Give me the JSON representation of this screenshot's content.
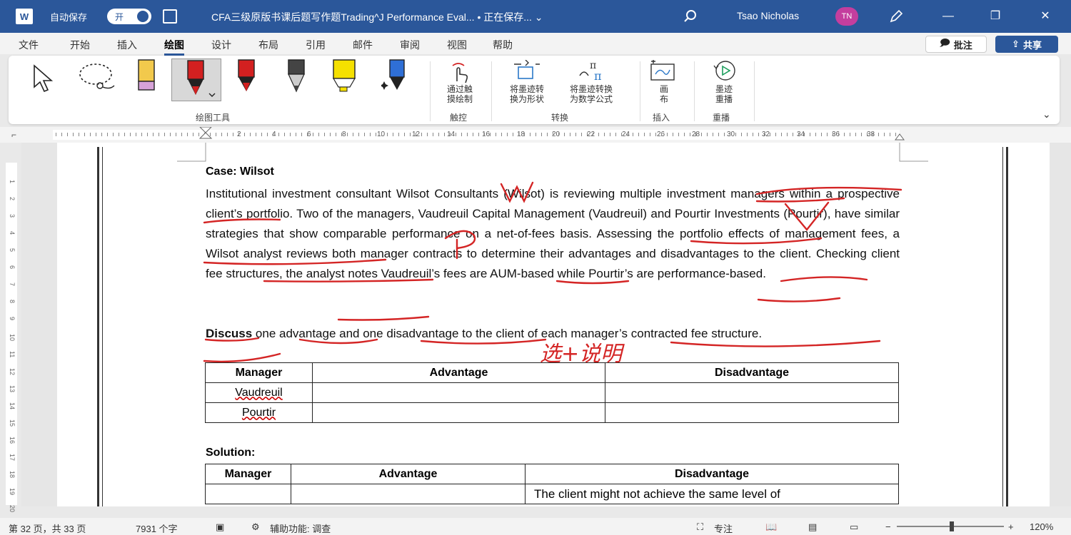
{
  "titlebar": {
    "app_icon": "W",
    "autosave_label": "自动保存",
    "autosave_state": "开",
    "doc_title": "CFA三级原版书课后题写作题Trading^J Performance Eval... • 正在保存... ⌄",
    "user_name": "Tsao Nicholas",
    "user_initials": "TN"
  },
  "menu": [
    "文件",
    "开始",
    "插入",
    "绘图",
    "设计",
    "布局",
    "引用",
    "邮件",
    "审阅",
    "视图",
    "帮助"
  ],
  "menu_active": "绘图",
  "buttons": {
    "comment": "批注",
    "share": "共享"
  },
  "ribbon": {
    "group_draw_tools": "绘图工具",
    "touch_draw_l1": "通过触",
    "touch_draw_l2": "摸绘制",
    "group_touch": "触控",
    "ink_to_shape_l1": "将墨迹转",
    "ink_to_shape_l2": "换为形状",
    "ink_to_math_l1": "将墨迹转换",
    "ink_to_math_l2": "为数学公式",
    "group_convert": "转换",
    "canvas_l1": "画",
    "canvas_l2": "布",
    "group_insert": "插入",
    "replay_l1": "墨迹",
    "replay_l2": "重播",
    "group_replay": "重播",
    "pen_colors": [
      "#f2c94c",
      "#d32020",
      "#d32020",
      "#444444",
      "#f5e000",
      "#2f6fd6"
    ]
  },
  "ruler_marks": [
    "2",
    "4",
    "6",
    "8",
    "10",
    "12",
    "14",
    "16",
    "18",
    "20",
    "22",
    "24",
    "26",
    "28",
    "30",
    "32",
    "34",
    "36",
    "38"
  ],
  "vruler_marks": [
    "1",
    "2",
    "3",
    "4",
    "5",
    "6",
    "7",
    "8",
    "9",
    "10",
    "11",
    "12",
    "13",
    "14",
    "15",
    "16",
    "17",
    "18",
    "19",
    "20"
  ],
  "document": {
    "case_label": "Case",
    "case_name": ": Wilsot",
    "paragraph": "Institutional investment consultant Wilsot Consultants (Wilsot) is reviewing multiple investment managers within a prospective client’s portfolio. Two of the managers, Vaudreuil Capital Management (Vaudreuil) and Pourtir Investments (Pourtir), have similar strategies that show comparable performance on a net-of-fees basis. Assessing the portfolio effects of management fees, a Wilsot analyst reviews both manager contracts to determine their advantages and disadvantages to the client. Checking client fee structures, the analyst notes Vaudreuil’s fees are AUM-based while Pourtir’s are performance-based.",
    "discuss_bold": "Discuss",
    "discuss_rest": " one advantage and one disadvantage to the client of each manager’s contracted fee structure.",
    "table1": {
      "headers": [
        "Manager",
        "Advantage",
        "Disadvantage"
      ],
      "rows": [
        "Vaudreuil",
        "Pourtir"
      ]
    },
    "solution_label": "Solution:",
    "table2": {
      "headers": [
        "Manager",
        "Advantage",
        "Disadvantage"
      ],
      "first_cell_text": "The client might not achieve the same level of"
    },
    "handwriting": "选+说明"
  },
  "status": {
    "page": "第 32 页，共 33 页",
    "words": "7931 个字",
    "accessibility": "辅助功能: 调查",
    "focus": "专注",
    "zoom": "120%"
  }
}
